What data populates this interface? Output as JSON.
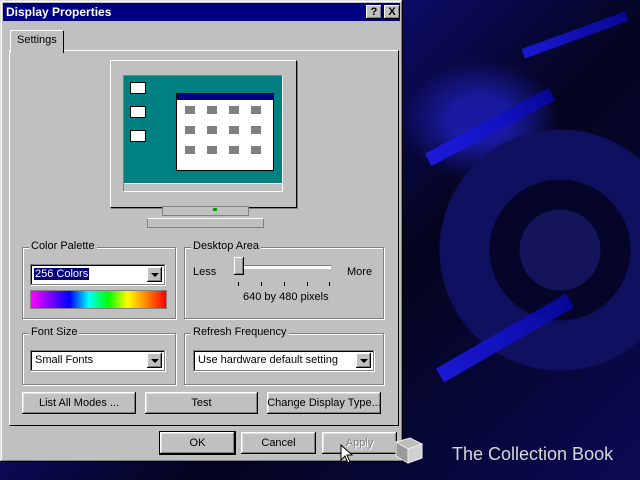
{
  "window": {
    "title": "Display Properties",
    "help_button": "?",
    "close_button": "X"
  },
  "tabs": [
    {
      "label": "Settings"
    }
  ],
  "color_palette": {
    "label": "Color Palette",
    "value": "256 Colors"
  },
  "desktop_area": {
    "label": "Desktop Area",
    "less": "Less",
    "more": "More",
    "resolution_text": "640 by 480 pixels",
    "slider_position_fraction": 0
  },
  "font_size": {
    "label": "Font Size",
    "value": "Small Fonts"
  },
  "refresh_frequency": {
    "label": "Refresh Frequency",
    "value": "Use hardware default setting"
  },
  "buttons": {
    "list_all_modes": "List All Modes ...",
    "test": "Test",
    "change_display_type": "Change Display Type...",
    "ok": "OK",
    "cancel": "Cancel",
    "apply": "Apply"
  },
  "watermark": "The Collection Book",
  "colors": {
    "titlebar": "#000080",
    "face": "#c0c0c0",
    "preview_desktop": "#008080"
  }
}
